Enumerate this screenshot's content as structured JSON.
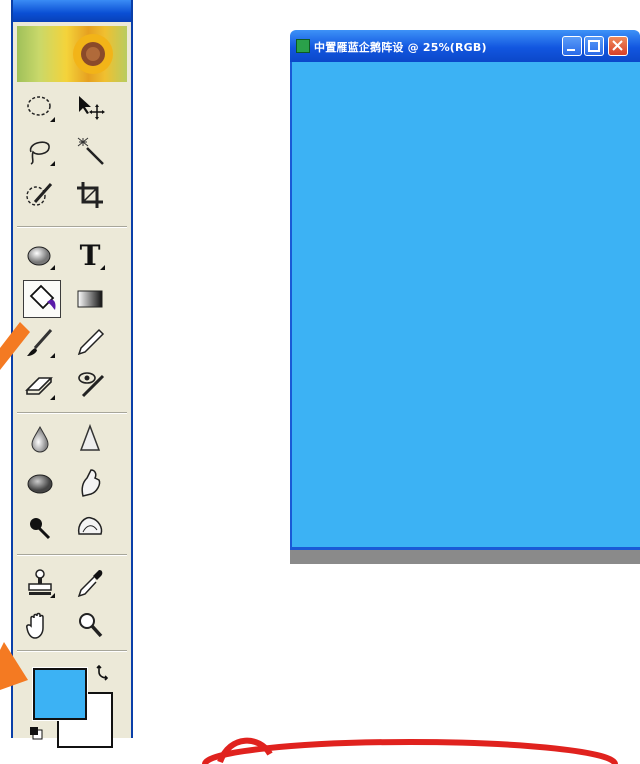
{
  "toolbox": {
    "tools": [
      {
        "name": "marquee-tool-icon"
      },
      {
        "name": "move-tool-icon"
      },
      {
        "name": "lasso-tool-icon"
      },
      {
        "name": "magic-wand-tool-icon"
      },
      {
        "name": "selection-brush-icon"
      },
      {
        "name": "crop-tool-icon"
      },
      {
        "name": "shape-tool-icon"
      },
      {
        "name": "type-tool-icon"
      },
      {
        "name": "paint-bucket-tool-icon"
      },
      {
        "name": "gradient-tool-icon"
      },
      {
        "name": "brush-tool-icon"
      },
      {
        "name": "pencil-tool-icon"
      },
      {
        "name": "eraser-tool-icon"
      },
      {
        "name": "red-eye-brush-icon"
      },
      {
        "name": "blur-tool-icon"
      },
      {
        "name": "sharpen-tool-icon"
      },
      {
        "name": "sponge-tool-icon"
      },
      {
        "name": "smudge-tool-icon"
      },
      {
        "name": "burn-tool-icon"
      },
      {
        "name": "dodge-tool-icon"
      },
      {
        "name": "clone-stamp-tool-icon"
      },
      {
        "name": "eyedropper-tool-icon"
      },
      {
        "name": "hand-tool-icon"
      },
      {
        "name": "zoom-tool-icon"
      }
    ],
    "type_tool_label": "T",
    "active_tool": "paint-bucket-tool-icon",
    "foreground_color": "#3cb2f4",
    "background_color": "#ffffff"
  },
  "document": {
    "title": "中置雁蓝企鹅阵设 @ 25%(RGB)",
    "canvas_color": "#3cb2f4"
  },
  "annotations": {
    "arrow_color": "#f47a22",
    "ellipse_color": "#e0221e"
  }
}
